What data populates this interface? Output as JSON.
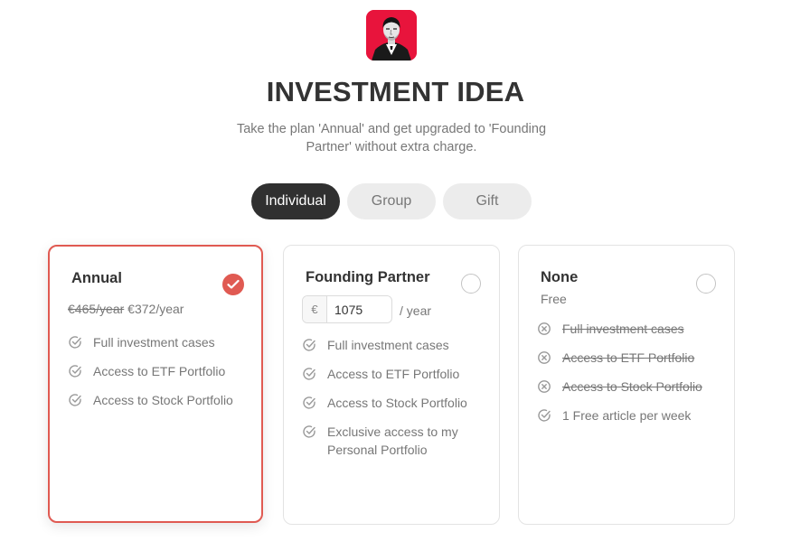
{
  "header": {
    "logo_icon": "author-portrait-icon",
    "title": "INVESTMENT IDEA",
    "subtitle": "Take the plan 'Annual' and get upgraded to 'Founding Partner' without extra charge."
  },
  "tabs": [
    {
      "label": "Individual",
      "active": true
    },
    {
      "label": "Group",
      "active": false
    },
    {
      "label": "Gift",
      "active": false
    }
  ],
  "plans": {
    "annual": {
      "title": "Annual",
      "selected": true,
      "old_price": "€465/year",
      "new_price": "€372/year",
      "features": [
        "Full investment cases",
        "Access to ETF Portfolio",
        "Access to Stock Portfolio"
      ]
    },
    "founding": {
      "title": "Founding Partner",
      "selected": false,
      "currency": "€",
      "amount": "1075",
      "per": "/ year",
      "features": [
        "Full investment cases",
        "Access to ETF Portfolio",
        "Access to Stock Portfolio",
        "Exclusive access to my Personal Portfolio"
      ]
    },
    "none": {
      "title": "None",
      "selected": false,
      "price": "Free",
      "excluded_features": [
        "Full investment cases",
        "Access to ETF Portfolio",
        "Access to Stock Portfolio"
      ],
      "features": [
        "1 Free article per week"
      ]
    }
  },
  "colors": {
    "accent": "#e05a52",
    "logo_background": "#e8143c",
    "active_tab": "#303030",
    "inactive_tab": "#ececec"
  }
}
